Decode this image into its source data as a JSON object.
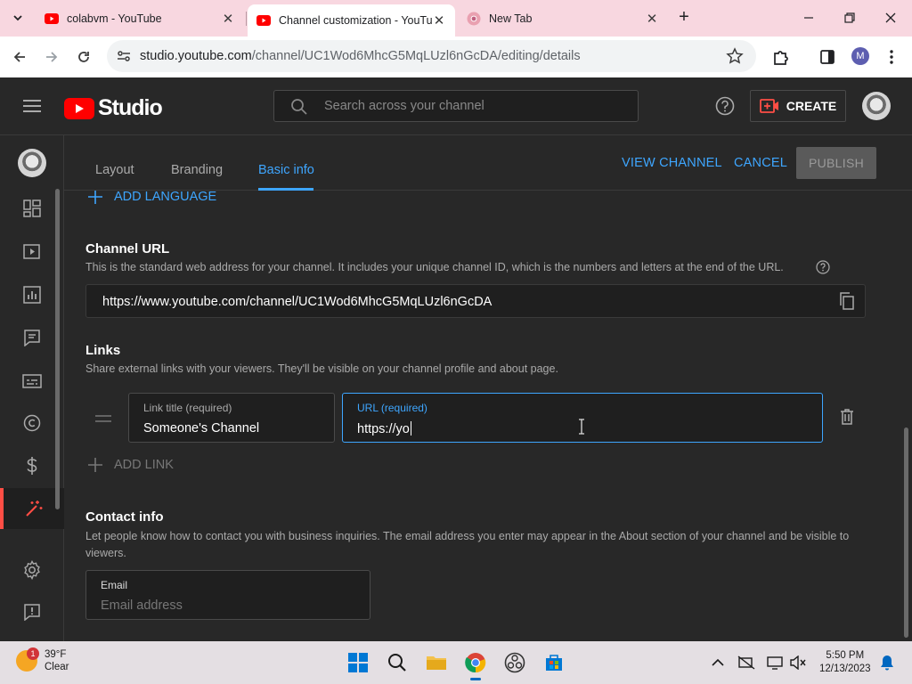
{
  "browser": {
    "tabs": [
      {
        "title": "colabvm - YouTube",
        "favicon": "youtube-icon",
        "active": false
      },
      {
        "title": "Channel customization - YouTu",
        "favicon": "youtube-studio-icon",
        "active": true
      },
      {
        "title": "New Tab",
        "favicon": "chrome-icon",
        "active": false
      }
    ],
    "url_host": "studio.youtube.com",
    "url_path": "/channel/UC1Wod6MhcG5MqLUzl6nGcDA/editing/details",
    "profile_initial": "M"
  },
  "header": {
    "logo_text": "Studio",
    "search_placeholder": "Search across your channel",
    "create_label": "CREATE"
  },
  "tabs": {
    "layout": "Layout",
    "branding": "Branding",
    "basic_info": "Basic info",
    "view_channel": "VIEW CHANNEL",
    "cancel": "CANCEL",
    "publish": "PUBLISH"
  },
  "content": {
    "add_language": "ADD LANGUAGE",
    "channel_url": {
      "title": "Channel URL",
      "description": "This is the standard web address for your channel. It includes your unique channel ID, which is the numbers and letters at the end of the URL.",
      "value": "https://www.youtube.com/channel/UC1Wod6MhcG5MqLUzl6nGcDA"
    },
    "links": {
      "title": "Links",
      "description": "Share external links with your viewers. They'll be visible on your channel profile and about page.",
      "link_title_label": "Link title (required)",
      "link_title_value": "Someone's Channel",
      "url_label": "URL (required)",
      "url_value": "https://yo",
      "add_link": "ADD LINK"
    },
    "contact": {
      "title": "Contact info",
      "description": "Let people know how to contact you with business inquiries. The email address you enter may appear in the About section of your channel and be visible to viewers.",
      "email_label": "Email",
      "email_placeholder": "Email address"
    }
  },
  "taskbar": {
    "weather_temp": "39°F",
    "weather_desc": "Clear",
    "weather_badge": "1",
    "time": "5:50 PM",
    "date": "12/13/2023"
  },
  "colors": {
    "accent": "#3ea6ff",
    "brand_red": "#ff0000",
    "background": "#282828",
    "active_nav": "#ff4e45"
  }
}
